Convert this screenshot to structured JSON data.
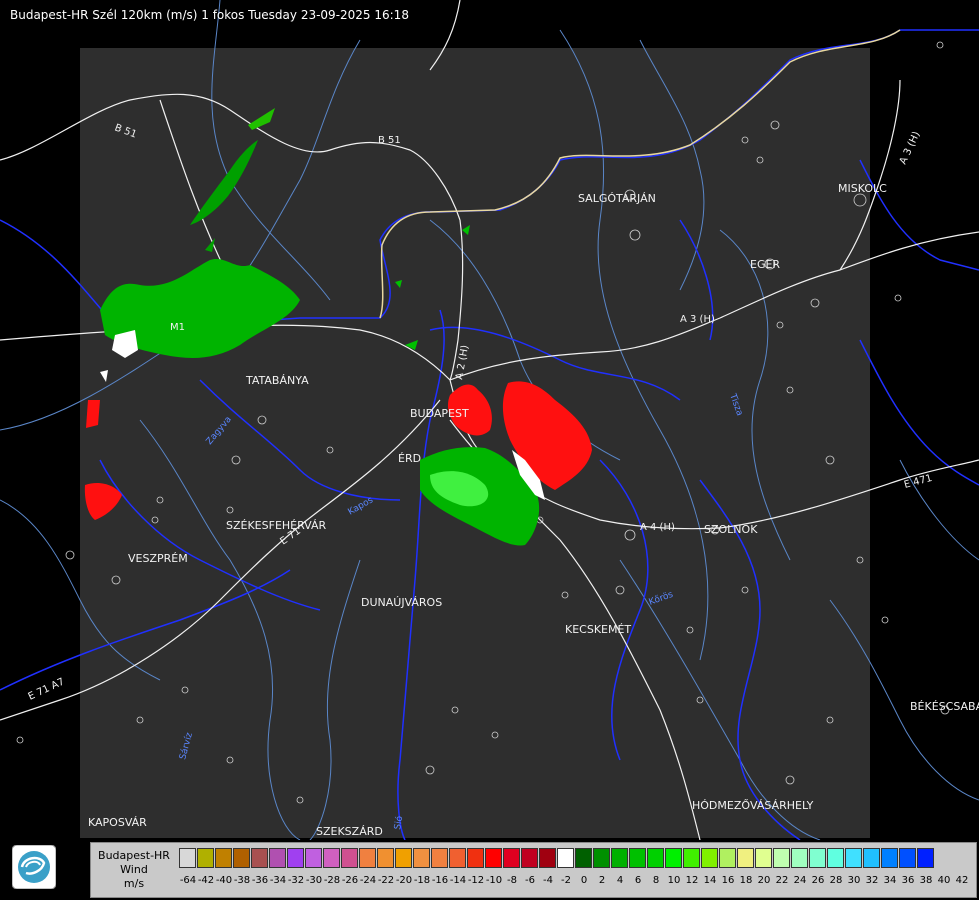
{
  "header": {
    "title": "Budapest-HR Szél 120km (m/s) 1 fokos Tuesday 23-09-2025 16:18"
  },
  "cities": [
    {
      "id": "salgotarjan",
      "name": "SALGÓTARJÁN"
    },
    {
      "id": "miskolc",
      "name": "MISKOLC"
    },
    {
      "id": "eger",
      "name": "EGER"
    },
    {
      "id": "tatabanya",
      "name": "TATABÁNYA"
    },
    {
      "id": "budapest",
      "name": "BUDAPEST"
    },
    {
      "id": "erd",
      "name": "ÉRD"
    },
    {
      "id": "szekesfehervar",
      "name": "SZÉKESFEHÉRVÁR"
    },
    {
      "id": "veszprem",
      "name": "VESZPRÉM"
    },
    {
      "id": "dunaujvaros",
      "name": "DUNAÚJVÁROS"
    },
    {
      "id": "szolnok",
      "name": "SZOLNOK"
    },
    {
      "id": "kecskemet",
      "name": "KECSKEMÉT"
    },
    {
      "id": "bekescsaba",
      "name": "BÉKÉSCSABA"
    },
    {
      "id": "hodmezovasarhely",
      "name": "HÓDMEZŐVÁSÁRHELY"
    },
    {
      "id": "kaposvar",
      "name": "KAPOSVÁR"
    },
    {
      "id": "szekszard",
      "name": "SZEKSZÁRD"
    }
  ],
  "roads": {
    "b51_west": "B 51",
    "b51_east": "B 51",
    "m1": "M1",
    "a2": "A 2 (H)",
    "a3": "A 3 (H)",
    "a3_ne": "A 3 (H)",
    "a4": "A 4 (H)",
    "e471": "E 471",
    "e71": "E 71 A7",
    "e71_mid": "E 71"
  },
  "rivers": {
    "zagyva": "Zagyva",
    "sarviz": "Sárvíz",
    "tisza": "Tisza",
    "koros": "Kőrös",
    "danube_sio": "Sió",
    "kapos": "Kapos"
  },
  "legend": {
    "name": "Budapest-HR",
    "quantity": "Wind",
    "unit": "m/s",
    "swatches": [
      "#d8d8d8",
      "#b0b000",
      "#c08000",
      "#b06000",
      "#a85050",
      "#b050b0",
      "#a040f0",
      "#c060e0",
      "#d060c0",
      "#d05090",
      "#f08040",
      "#f09030",
      "#f0a000",
      "#f09040",
      "#f08040",
      "#f06030",
      "#f03010",
      "#ff0000",
      "#e00020",
      "#c00020",
      "#a00010",
      "#ffffff",
      "#006000",
      "#009000",
      "#00b000",
      "#00c000",
      "#00d000",
      "#00f000",
      "#40f000",
      "#80f000",
      "#b0f060",
      "#f0f080",
      "#e0ff90",
      "#c0ffb0",
      "#a0ffc0",
      "#80ffd0",
      "#60ffe0",
      "#40e0ff",
      "#20c0ff",
      "#0080ff",
      "#0050ff",
      "#0020ff"
    ],
    "ticks": [
      "-64",
      "-42",
      "-40",
      "-38",
      "-36",
      "-34",
      "-32",
      "-30",
      "-28",
      "-26",
      "-24",
      "-22",
      "-20",
      "-18",
      "-16",
      "-14",
      "-12",
      "-10",
      "-8",
      "-6",
      "-4",
      "-2",
      "0",
      "2",
      "4",
      "6",
      "8",
      "10",
      "12",
      "14",
      "16",
      "18",
      "20",
      "22",
      "24",
      "26",
      "28",
      "30",
      "32",
      "34",
      "36",
      "38",
      "40",
      "42"
    ]
  },
  "colors": {
    "background": "#000000",
    "coverage": "#2e2e2e",
    "border_blue": "#2030ff",
    "river_blue": "#5080c0",
    "road_white": "#ffffff",
    "approaching": "#ff0000",
    "receding": "#00c000"
  }
}
